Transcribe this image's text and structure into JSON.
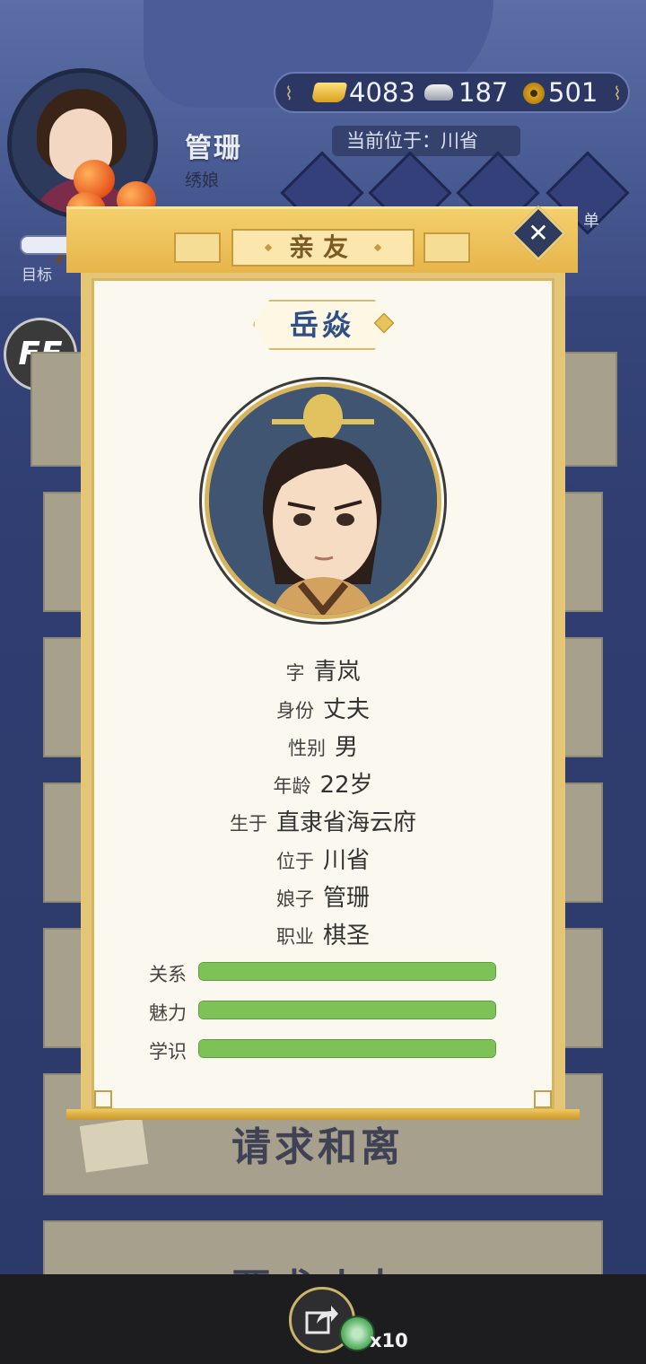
{
  "player": {
    "name": "管珊",
    "role": "绣娘",
    "goal_label": "目标"
  },
  "currency": {
    "gold": "4083",
    "silver": "187",
    "coins": "501"
  },
  "location": {
    "text": "当前位于：川省"
  },
  "menu": {
    "last_label": "单"
  },
  "ff_badge": "FF",
  "background_cards": {
    "card_divorce": "请求和离",
    "card_husband": "要求丈夫"
  },
  "panel": {
    "title": "亲友",
    "close_symbol": "✕"
  },
  "character": {
    "name": "岳焱",
    "info": [
      {
        "label": "字",
        "value": "青岚"
      },
      {
        "label": "身份",
        "value": "丈夫"
      },
      {
        "label": "性别",
        "value": "男"
      },
      {
        "label": "年龄",
        "value": "22岁"
      },
      {
        "label": "生于",
        "value": "直隶省海云府"
      },
      {
        "label": "位于",
        "value": "川省"
      },
      {
        "label": "娘子",
        "value": "管珊"
      },
      {
        "label": "职业",
        "value": "棋圣"
      }
    ],
    "stats": [
      {
        "label": "关系",
        "fraction": 1.0
      },
      {
        "label": "魅力",
        "fraction": 1.0
      },
      {
        "label": "学识",
        "fraction": 1.0
      }
    ]
  },
  "bottom_bar": {
    "share_icon": "share-icon",
    "count": "x10"
  }
}
